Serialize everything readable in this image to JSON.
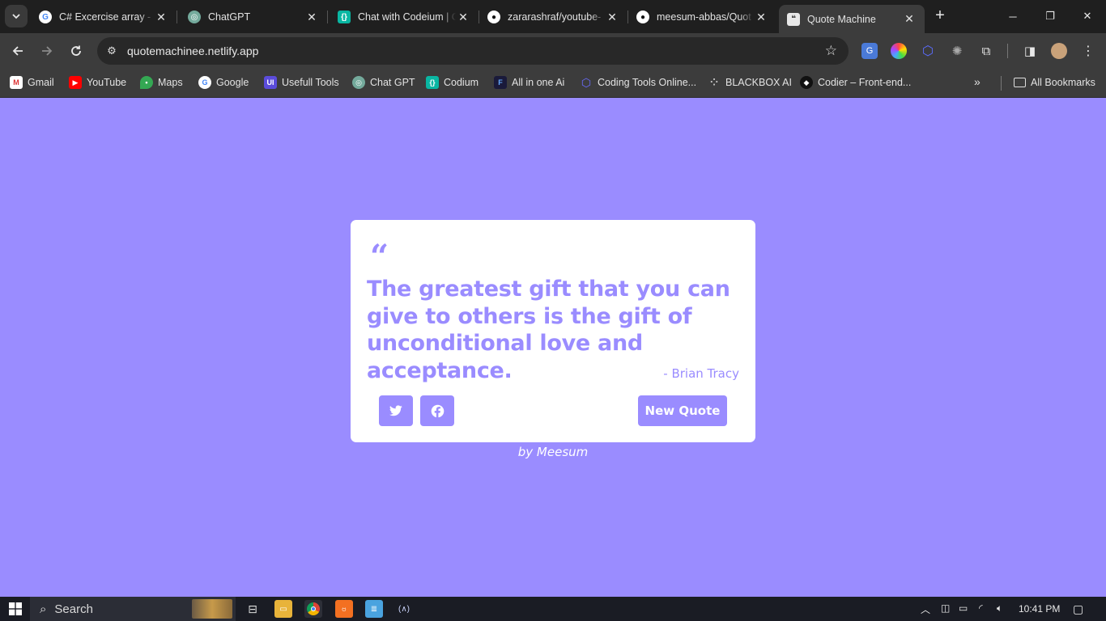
{
  "browser": {
    "tabs": [
      {
        "title": "C# Excercise array - G",
        "favicon": "google-icon"
      },
      {
        "title": "ChatGPT",
        "favicon": "chatgpt-icon"
      },
      {
        "title": "Chat with Codeium | C",
        "favicon": "codeium-icon"
      },
      {
        "title": "zararashraf/youtube-",
        "favicon": "github-icon"
      },
      {
        "title": "meesum-abbas/Quot",
        "favicon": "github-icon"
      },
      {
        "title": "Quote Machine",
        "favicon": "quote-icon",
        "active": true
      }
    ],
    "url": "quotemachinee.netlify.app",
    "bookmarks": [
      {
        "label": "Gmail",
        "icon": "gmail-icon"
      },
      {
        "label": "YouTube",
        "icon": "youtube-icon"
      },
      {
        "label": "Maps",
        "icon": "maps-icon"
      },
      {
        "label": "Google",
        "icon": "google-icon"
      },
      {
        "label": "Usefull Tools",
        "icon": "tools-icon"
      },
      {
        "label": "Chat GPT",
        "icon": "chatgpt-icon"
      },
      {
        "label": "Codium",
        "icon": "codeium-icon"
      },
      {
        "label": "All in one Ai",
        "icon": "ai-icon"
      },
      {
        "label": "Coding Tools Online...",
        "icon": "coding-icon"
      },
      {
        "label": "BLACKBOX AI",
        "icon": "blackbox-icon"
      },
      {
        "label": "Codier – Front-end...",
        "icon": "codier-icon"
      }
    ],
    "all_bookmarks": "All Bookmarks"
  },
  "quote_card": {
    "quote_mark": "“",
    "text": "The greatest gift that you can give to others is the gift of unconditional love and acceptance.",
    "author": "- Brian Tracy",
    "new_quote_label": "New Quote",
    "accent_color": "#9a8cff"
  },
  "footer": {
    "byline": "by Meesum"
  },
  "taskbar": {
    "search_label": "Search",
    "time": "10:41 PM"
  }
}
